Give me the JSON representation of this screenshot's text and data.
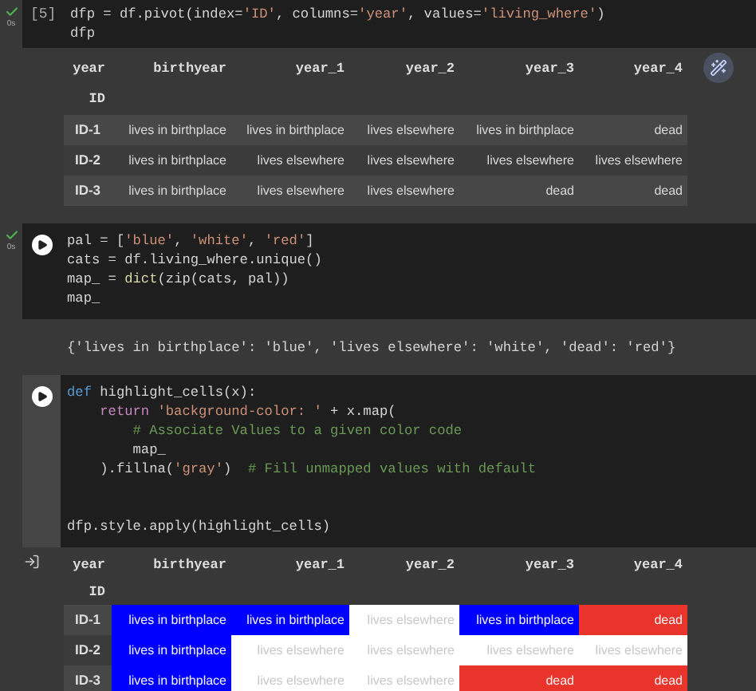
{
  "cells": [
    {
      "status": {
        "done": true,
        "time": "0s"
      },
      "control": {
        "kind": "count",
        "text": "[5]"
      },
      "focused": false,
      "code": [
        {
          "kind": "code",
          "tokens": [
            {
              "kind": "plain",
              "text": "dfp = df.pivot(index="
            },
            {
              "kind": "string",
              "text": "'ID'"
            },
            {
              "kind": "plain",
              "text": ", columns="
            },
            {
              "kind": "string",
              "text": "'year'"
            },
            {
              "kind": "plain",
              "text": ", values="
            },
            {
              "kind": "string",
              "text": "'living_where'"
            },
            {
              "kind": "plain",
              "text": ")"
            }
          ]
        },
        {
          "kind": "code",
          "tokens": [
            {
              "kind": "plain",
              "text": "dfp"
            }
          ]
        }
      ],
      "output": {
        "kind": "table",
        "show_icon": false,
        "wand": true,
        "index_name": "year",
        "index_label": "ID",
        "columns": [
          "birthyear",
          "year_1",
          "year_2",
          "year_3",
          "year_4"
        ],
        "rows": [
          {
            "label": "ID-1",
            "cells": [
              {
                "text": "lives in birthplace"
              },
              {
                "text": "lives in birthplace"
              },
              {
                "text": "lives elsewhere"
              },
              {
                "text": "lives in birthplace"
              },
              {
                "text": "dead"
              }
            ]
          },
          {
            "label": "ID-2",
            "cells": [
              {
                "text": "lives in birthplace"
              },
              {
                "text": "lives elsewhere"
              },
              {
                "text": "lives elsewhere"
              },
              {
                "text": "lives elsewhere"
              },
              {
                "text": "lives elsewhere"
              }
            ]
          },
          {
            "label": "ID-3",
            "cells": [
              {
                "text": "lives in birthplace"
              },
              {
                "text": "lives elsewhere"
              },
              {
                "text": "lives elsewhere"
              },
              {
                "text": "dead"
              },
              {
                "text": "dead"
              }
            ]
          }
        ]
      }
    },
    {
      "status": {
        "done": true,
        "time": "0s"
      },
      "control": {
        "kind": "run"
      },
      "focused": false,
      "code": [
        {
          "kind": "code",
          "tokens": [
            {
              "kind": "plain",
              "text": "pal = ["
            },
            {
              "kind": "string",
              "text": "'blue'"
            },
            {
              "kind": "plain",
              "text": ", "
            },
            {
              "kind": "string",
              "text": "'white'"
            },
            {
              "kind": "plain",
              "text": ", "
            },
            {
              "kind": "string",
              "text": "'red'"
            },
            {
              "kind": "plain",
              "text": "]"
            }
          ]
        },
        {
          "kind": "code",
          "tokens": [
            {
              "kind": "plain",
              "text": "cats = df.living_where.unique()"
            }
          ]
        },
        {
          "kind": "code",
          "tokens": [
            {
              "kind": "plain",
              "text": "map_ = "
            },
            {
              "kind": "function",
              "text": "dict"
            },
            {
              "kind": "plain",
              "text": "(zip(cats, pal))"
            }
          ]
        },
        {
          "kind": "code",
          "tokens": [
            {
              "kind": "plain",
              "text": "map_"
            }
          ]
        }
      ],
      "output": {
        "kind": "text",
        "text": "{'lives in birthplace': 'blue', 'lives elsewhere': 'white', 'dead': 'red'}"
      }
    },
    {
      "control": {
        "kind": "run"
      },
      "focused": true,
      "code": [
        {
          "kind": "code",
          "tokens": [
            {
              "kind": "keyword",
              "text": "def"
            },
            {
              "kind": "plain",
              "text": " highlight_cells(x):"
            }
          ]
        },
        {
          "kind": "code",
          "tokens": [
            {
              "kind": "control",
              "text": "    return "
            },
            {
              "kind": "string",
              "text": "'background-color: '"
            },
            {
              "kind": "plain",
              "text": " + x.map("
            }
          ]
        },
        {
          "kind": "code",
          "tokens": [
            {
              "kind": "comment",
              "text": "        # Associate Values to a given color code"
            }
          ]
        },
        {
          "kind": "code",
          "tokens": [
            {
              "kind": "plain",
              "text": "        map_"
            }
          ]
        },
        {
          "kind": "code",
          "tokens": [
            {
              "kind": "plain",
              "text": "    ).fillna("
            },
            {
              "kind": "string",
              "text": "'gray'"
            },
            {
              "kind": "plain",
              "text": ")  "
            },
            {
              "kind": "comment",
              "text": "# Fill unmapped values with default"
            }
          ]
        },
        {
          "kind": "blank"
        },
        {
          "kind": "blank"
        },
        {
          "kind": "code",
          "tokens": [
            {
              "kind": "plain",
              "text": "dfp.style.apply(highlight_cells)"
            }
          ]
        }
      ],
      "output": {
        "kind": "table",
        "show_icon": true,
        "wand": false,
        "index_name": "year",
        "index_label": "ID",
        "columns": [
          "birthyear",
          "year_1",
          "year_2",
          "year_3",
          "year_4"
        ],
        "rows": [
          {
            "label": "ID-1",
            "cells": [
              {
                "text": "lives in birthplace",
                "color": "#0000ff"
              },
              {
                "text": "lives in birthplace",
                "color": "#0000ff"
              },
              {
                "text": "lives elsewhere",
                "color": "#ffffff"
              },
              {
                "text": "lives in birthplace",
                "color": "#0000ff"
              },
              {
                "text": "dead",
                "color": "#e8342a"
              }
            ]
          },
          {
            "label": "ID-2",
            "cells": [
              {
                "text": "lives in birthplace",
                "color": "#0000ff"
              },
              {
                "text": "lives elsewhere",
                "color": "#ffffff"
              },
              {
                "text": "lives elsewhere",
                "color": "#ffffff"
              },
              {
                "text": "lives elsewhere",
                "color": "#ffffff"
              },
              {
                "text": "lives elsewhere",
                "color": "#ffffff"
              }
            ]
          },
          {
            "label": "ID-3",
            "cells": [
              {
                "text": "lives in birthplace",
                "color": "#0000ff"
              },
              {
                "text": "lives elsewhere",
                "color": "#ffffff"
              },
              {
                "text": "lives elsewhere",
                "color": "#ffffff"
              },
              {
                "text": "dead",
                "color": "#e8342a"
              },
              {
                "text": "dead",
                "color": "#e8342a"
              }
            ]
          }
        ]
      }
    }
  ]
}
